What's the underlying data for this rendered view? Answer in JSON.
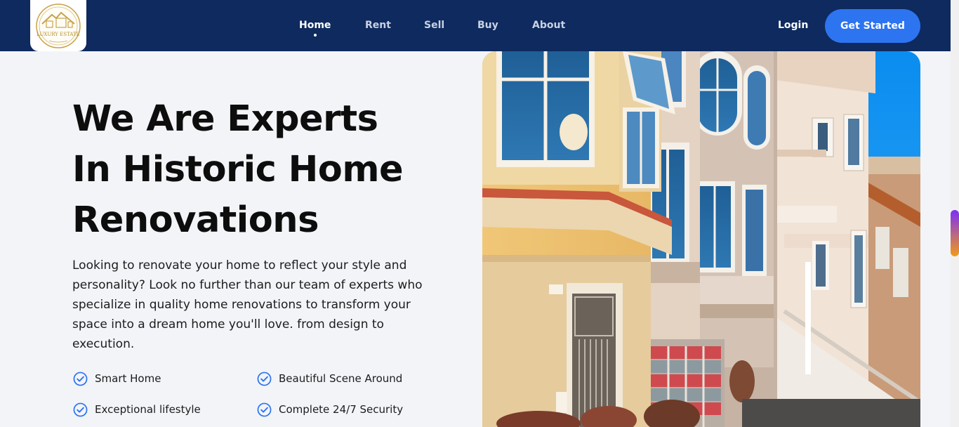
{
  "header": {
    "logo": {
      "text": "LUXURY ESTATE",
      "icon": "house-logo-icon"
    },
    "nav": [
      {
        "label": "Home",
        "active": true
      },
      {
        "label": "Rent",
        "active": false
      },
      {
        "label": "Sell",
        "active": false
      },
      {
        "label": "Buy",
        "active": false
      },
      {
        "label": "About",
        "active": false
      }
    ],
    "login_label": "Login",
    "cta_label": "Get Started"
  },
  "hero": {
    "title_lines": [
      "We Are Experts",
      "In Historic Home",
      "Renovations"
    ],
    "description": "Looking to renovate your home to reflect your style and personality? Look no further than our team of experts who specialize in quality home renovations to transform your space into a dream home you'll love. from design to execution.",
    "features": [
      {
        "label": "Smart Home",
        "icon": "check-circle-icon"
      },
      {
        "label": "Beautiful Scene Around",
        "icon": "check-circle-icon"
      },
      {
        "label": "Exceptional lifestyle",
        "icon": "check-circle-icon"
      },
      {
        "label": "Complete 24/7 Security",
        "icon": "check-circle-icon"
      }
    ]
  },
  "colors": {
    "header_bg": "#0e2a5e",
    "accent": "#2d74f0",
    "page_bg": "#f2f4f8",
    "logo_gold": "#c9a24a"
  }
}
